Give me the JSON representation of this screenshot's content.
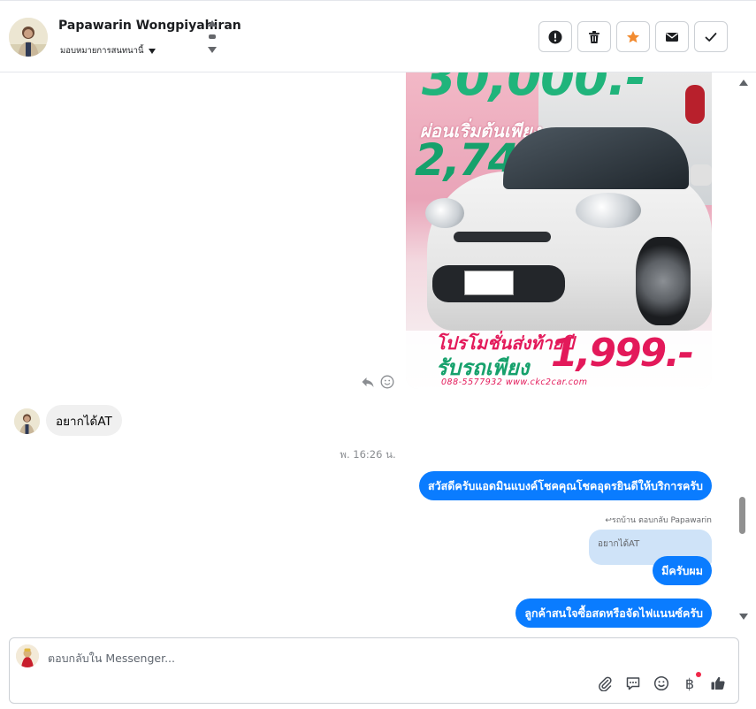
{
  "header": {
    "contact_name": "Papawarin Wongpiyahiran",
    "assign_label": "มอบหมายการสนทนานี้"
  },
  "actions": [
    {
      "name": "report-icon",
      "label": "Report"
    },
    {
      "name": "trash-icon",
      "label": "Delete"
    },
    {
      "name": "star-icon",
      "label": "Star"
    },
    {
      "name": "envelope-icon",
      "label": "Mark unread"
    },
    {
      "name": "check-icon",
      "label": "Done"
    }
  ],
  "ad": {
    "price_big": "30,000.-",
    "installment_label": "ผ่อนเริ่มต้นเพียง",
    "installment_value": "2,747",
    "promo_line1": "โปรโมชั่นส่งท้ายปี",
    "promo_line2": "รับรถเพียง",
    "promo_price": "1,999.-",
    "contact": "088-5577932  www.ckc2car.com"
  },
  "messages": {
    "incoming_1": "อยากได้AT",
    "timestamp": "พ. 16:26 น.",
    "outgoing_1": "สวัสดีครับแอดมินแบงค์โชคคุณโชคอุดรยินดีให้บริการครับ",
    "reply_meta": "↩รถบ้าน ตอบกลับ Papawarin",
    "quoted_text": "อยากได้AT",
    "outgoing_2": "มีครับผม",
    "outgoing_3": "ลูกค้าสนใจซื้อสดหรือจัดไฟแนนซ์ครับ"
  },
  "composer": {
    "placeholder": "ตอบกลับใน Messenger...",
    "value": "",
    "currency_symbol": "฿"
  },
  "colors": {
    "outgoing_bubble": "#0a7cff",
    "incoming_bubble": "#f0f0f0",
    "star_accent": "#f28b30",
    "badge": "#f02849"
  }
}
